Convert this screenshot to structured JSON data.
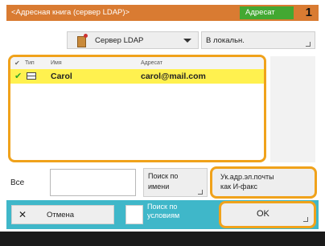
{
  "title_bar": {
    "title": "<Адресная книга (сервер LDAP)>",
    "destination_tab_label": "Адресат",
    "destination_count": "1",
    "accent_color": "#d97b32",
    "tab_color": "#43a832"
  },
  "source": {
    "selected_value": "Сервер LDAP",
    "icon": "ldap-server-icon",
    "local_button_label": "В локальн."
  },
  "list": {
    "columns": {
      "type": "Тип",
      "name": "Имя",
      "address": "Адресат"
    },
    "rows": [
      {
        "checked": "✔",
        "type_icon": "email-icon",
        "name": "Carol",
        "address": "carol@mail.com"
      }
    ],
    "highlight_color": "#fff14f"
  },
  "search": {
    "all_label": "Все",
    "input_value": "",
    "name_search_line1": "Поиск по",
    "name_search_line2": "имени",
    "fax_line1": "Ук.адр.эл.почты",
    "fax_line2": "как И-факс"
  },
  "footer": {
    "cancel_label": "Отмена",
    "condition_line1": "Поиск по",
    "condition_line2": "условиям",
    "ok_label": "OK",
    "footer_color": "#3fb7c9"
  }
}
